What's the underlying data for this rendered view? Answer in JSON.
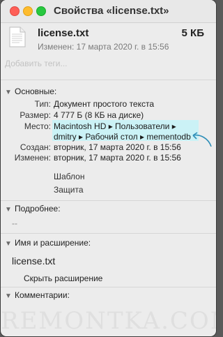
{
  "window": {
    "title": "Свойства «license.txt»"
  },
  "file": {
    "name": "license.txt",
    "size": "5 КБ",
    "modified": "Изменен: 17 марта 2020 г. в 15:56",
    "tags_placeholder": "Добавить теги..."
  },
  "general": {
    "header": "Основные:",
    "rows": [
      {
        "label": "Тип:",
        "value": "Документ простого текста"
      },
      {
        "label": "Размер:",
        "value": "4 777 Б (8 КБ на диске)"
      },
      {
        "label": "Место:",
        "value": ""
      },
      {
        "label": "Создан:",
        "value": "вторник, 17 марта 2020 г. в 15:56"
      },
      {
        "label": "Изменен:",
        "value": "вторник, 17 марта 2020 г. в 15:56"
      }
    ],
    "location_line1": "Macintosh HD ▸ Пользователи ▸",
    "location_line2": "dmitry ▸ Рабочий стол ▸ mementodb",
    "template_label": "Шаблон",
    "locked_label": "Защита"
  },
  "more": {
    "header": "Подробнее:",
    "value": "--"
  },
  "name_ext": {
    "header": "Имя и расширение:",
    "filename": "license.txt",
    "hide_extension_label": "Скрыть расширение"
  },
  "comments": {
    "header": "Комментарии:"
  },
  "watermark": "REMONTKA.COM",
  "colors": {
    "highlight": "#cbf2f6",
    "arrow": "#2f8fb8"
  }
}
